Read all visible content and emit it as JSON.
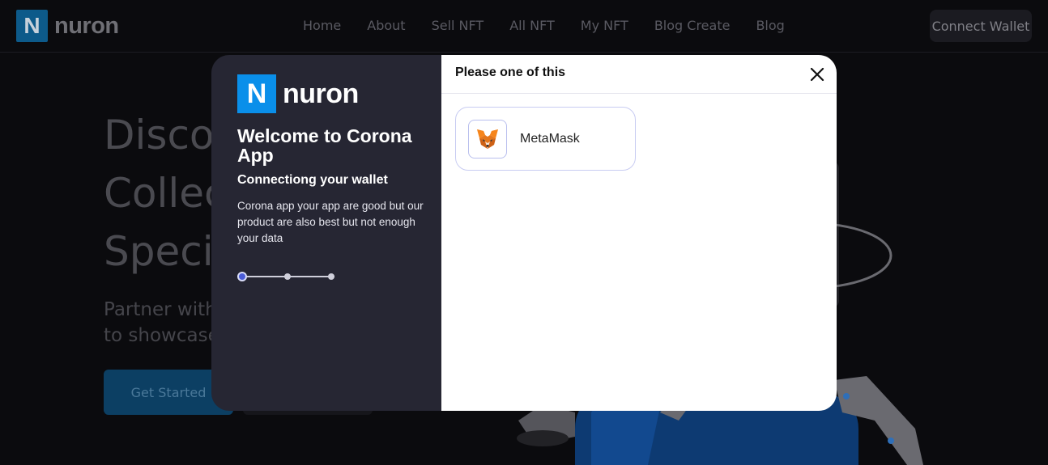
{
  "navbar": {
    "logo_letter": "N",
    "logo_text": "nuron",
    "links": [
      "Home",
      "About",
      "Sell NFT",
      "All NFT",
      "My NFT",
      "Blog Create",
      "Blog"
    ],
    "connect_label": "Connect Wallet"
  },
  "hero": {
    "line1": "Discov",
    "line2": "Collec",
    "line3": "Specif",
    "sub1": "Partner with",
    "sub2": "to showcase",
    "get_started": "Get Started"
  },
  "modal": {
    "logo_letter": "N",
    "logo_text": "nuron",
    "title": "Welcome to Corona App",
    "subtitle": "Connectiong your wallet",
    "description": "Corona app your app are good but our product are also best but not enough your data",
    "steps": {
      "total": 3,
      "current": 1
    },
    "right_title": "Please one of this",
    "close_icon": "close-icon",
    "wallets": [
      {
        "name": "MetaMask",
        "icon": "metamask-fox-icon"
      }
    ]
  },
  "colors": {
    "accent": "#0a8fea",
    "modal_left_bg": "#262633",
    "step_active": "#4a5bd6",
    "card_border": "#c8ccf2"
  }
}
